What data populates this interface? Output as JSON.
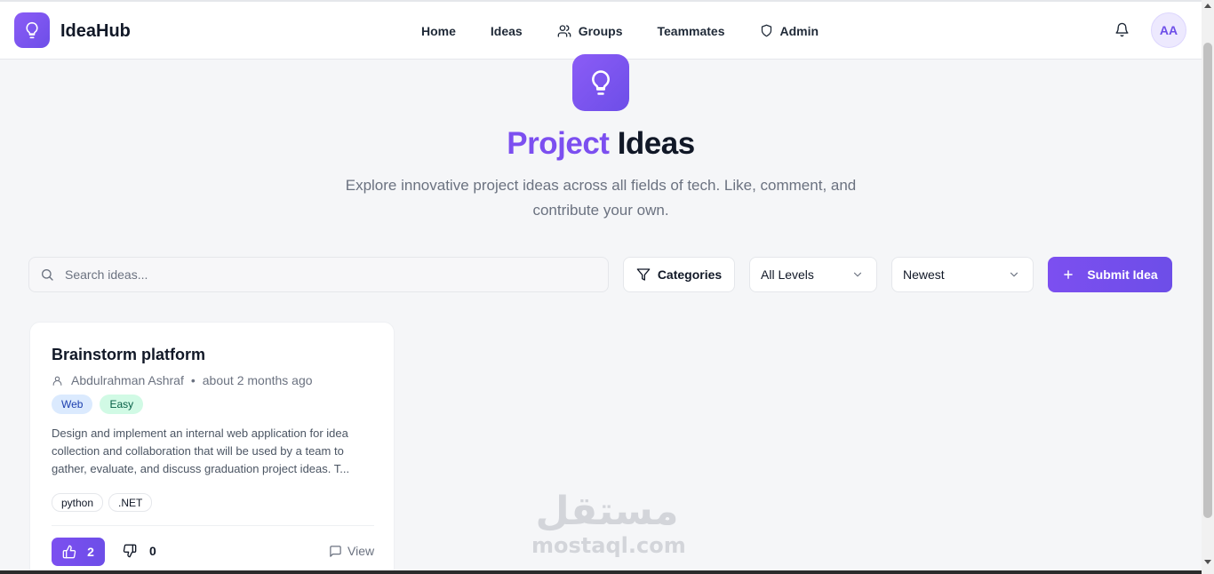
{
  "app": {
    "brand": "IdeaHub",
    "user_initials": "AA"
  },
  "nav": [
    {
      "label": "Home",
      "icon": null
    },
    {
      "label": "Ideas",
      "icon": null
    },
    {
      "label": "Groups",
      "icon": "users-icon"
    },
    {
      "label": "Teammates",
      "icon": null
    },
    {
      "label": "Admin",
      "icon": "shield-icon"
    }
  ],
  "hero": {
    "title_accent": "Project",
    "title_rest": "Ideas",
    "subtitle": "Explore innovative project ideas across all fields of tech. Like, comment, and contribute your own."
  },
  "toolbar": {
    "search_placeholder": "Search ideas...",
    "categories_label": "Categories",
    "level_selected": "All Levels",
    "sort_selected": "Newest",
    "submit_label": "Submit Idea"
  },
  "ideas": [
    {
      "title": "Brainstorm platform",
      "author": "Abdulrahman Ashraf",
      "separator": "•",
      "time": "about 2 months ago",
      "tags": [
        "Web",
        "Easy"
      ],
      "description": "Design and implement an internal web application for idea collection and collaboration that will be used by a team to gather, evaluate, and discuss graduation project ideas. T...",
      "technologies": [
        "python",
        ".NET"
      ],
      "likes": "2",
      "dislikes": "0",
      "view_label": "View"
    }
  ],
  "watermark": {
    "arabic": "مستقل",
    "latin": "mostaql.com"
  },
  "colors": {
    "accent": "#7c4ff0",
    "tag_web_bg": "#dbeafe",
    "tag_easy_bg": "#d1fae5"
  }
}
